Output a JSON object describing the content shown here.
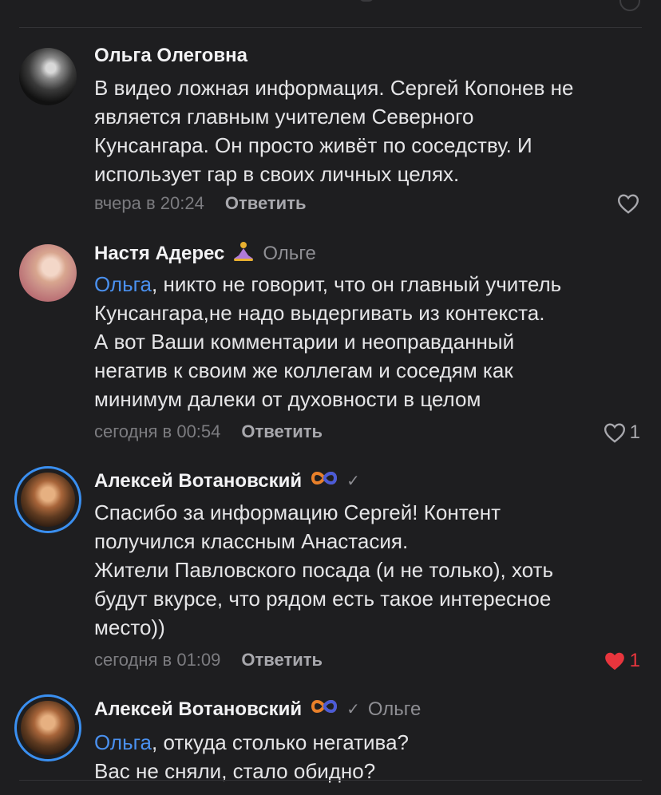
{
  "colors": {
    "background": "#1e1e20",
    "mention": "#4a90ee",
    "liked": "#e8353d",
    "verified_ring": "#3a8ff0"
  },
  "comments": [
    {
      "author": "Ольга Олеговна",
      "text_lines": [
        "В видео ложная информация. Сергей Копонев не",
        "является главным учителем Северного",
        "Кунсангара. Он просто живёт по соседству. И",
        "использует гар в своих личных целях."
      ],
      "time": "вчера в 20:24",
      "reply_label": "Ответить"
    },
    {
      "author": "Настя Адерес",
      "badge_icon": "lotus-icon",
      "reply_to": "Ольге",
      "mention": "Ольга",
      "text_first_rest": ", никто не говорит, что он главный учитель",
      "text_lines": [
        "Кунсангара,не надо выдергивать из контекста.",
        "А вот Ваши комментарии и неоправданный",
        "негатив к своим же коллегам и соседям   как",
        "минимум далеки от духовности в целом"
      ],
      "time": "сегодня в 00:54",
      "reply_label": "Ответить",
      "likes": "1",
      "liked": false
    },
    {
      "author": "Алексей Вотановский",
      "badge_icon": "infinity-icon",
      "text_lines": [
        "Спасибо за информацию Сергей! Контент",
        "получился классным Анастасия.",
        "Жители Павловского посада (и не только), хоть",
        "будут вкурсе, что рядом есть такое интересное",
        "место))"
      ],
      "time": "сегодня в 01:09",
      "reply_label": "Ответить",
      "likes": "1",
      "liked": true
    },
    {
      "author": "Алексей Вотановский",
      "badge_icon": "infinity-icon",
      "reply_to": "Ольге",
      "mention": "Ольга",
      "text_first_rest": ", откуда столько негатива?",
      "text_lines": [
        "Вас не сняли, стало обидно?"
      ]
    }
  ]
}
